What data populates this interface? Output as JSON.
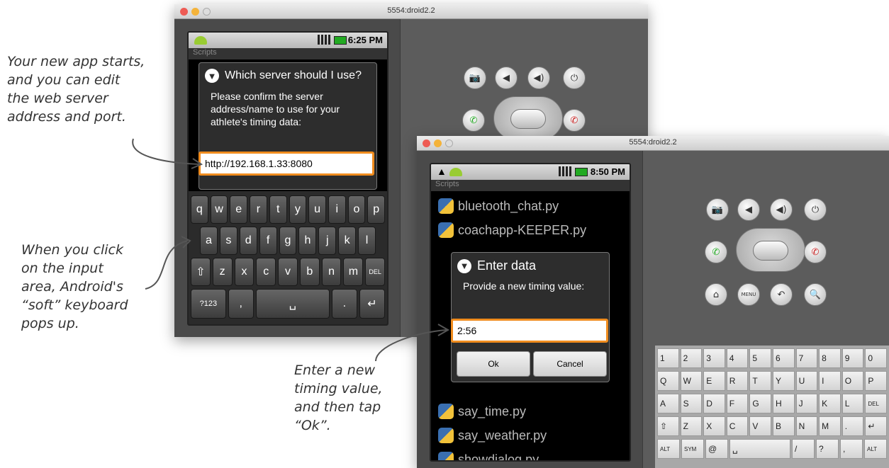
{
  "annotations": {
    "app_starts": "Your new app starts,\nand you can edit\nthe web server\naddress and port.",
    "soft_keyboard": "When you click\non the input\narea, Android's\n“soft” keyboard\npops up.",
    "enter_value": "Enter a new\ntiming value,\nand then tap\n“Ok”."
  },
  "window1": {
    "title": "5554:droid2.2",
    "status_time": "6:25 PM",
    "appbar": "Scripts",
    "dialog_title": "Which server should I use?",
    "dialog_message": "Please confirm the server address/name to use for your athlete's timing data:",
    "input_value": "http://192.168.1.33:8080",
    "keyboard_row1": [
      "q",
      "w",
      "e",
      "r",
      "t",
      "y",
      "u",
      "i",
      "o",
      "p"
    ],
    "keyboard_row2": [
      "a",
      "s",
      "d",
      "f",
      "g",
      "h",
      "j",
      "k",
      "l"
    ],
    "keyboard_row3": [
      "⇧",
      "z",
      "x",
      "c",
      "v",
      "b",
      "n",
      "m",
      "DEL"
    ],
    "keyboard_row4": [
      "?123",
      ",",
      "␣",
      ".",
      "↵"
    ]
  },
  "window2": {
    "title": "5554:droid2.2",
    "status_time": "8:50 PM",
    "appbar": "Scripts",
    "scripts": [
      "bluetooth_chat.py",
      "coachapp-KEEPER.py",
      "say_time.py",
      "say_weather.py",
      "showdialog.py"
    ],
    "dialog_title": "Enter data",
    "dialog_message": "Provide a new timing value:",
    "input_value": "2:56",
    "ok_label": "Ok",
    "cancel_label": "Cancel",
    "hw_row1": [
      "1",
      "2",
      "3",
      "4",
      "5",
      "6",
      "7",
      "8",
      "9",
      "0"
    ],
    "hw_row2": [
      "Q",
      "W",
      "E",
      "R",
      "T",
      "Y",
      "U",
      "I",
      "O",
      "P"
    ],
    "hw_row3": [
      "A",
      "S",
      "D",
      "F",
      "G",
      "H",
      "J",
      "K",
      "L",
      "DEL"
    ],
    "hw_row4": [
      "⇧",
      "Z",
      "X",
      "C",
      "V",
      "B",
      "N",
      "M",
      ".",
      "↵"
    ],
    "hw_row5": [
      "ALT",
      "SYM",
      "@",
      "␣",
      "/",
      "?",
      ",",
      "ALT"
    ]
  },
  "controls": {
    "camera_icon": "📷",
    "vol_down_icon": "◀",
    "vol_up_icon": "◀)",
    "power_icon": "⏻",
    "home_icon": "⌂",
    "menu_label": "MENU",
    "back_icon": "↶",
    "search_icon": "🔍"
  }
}
